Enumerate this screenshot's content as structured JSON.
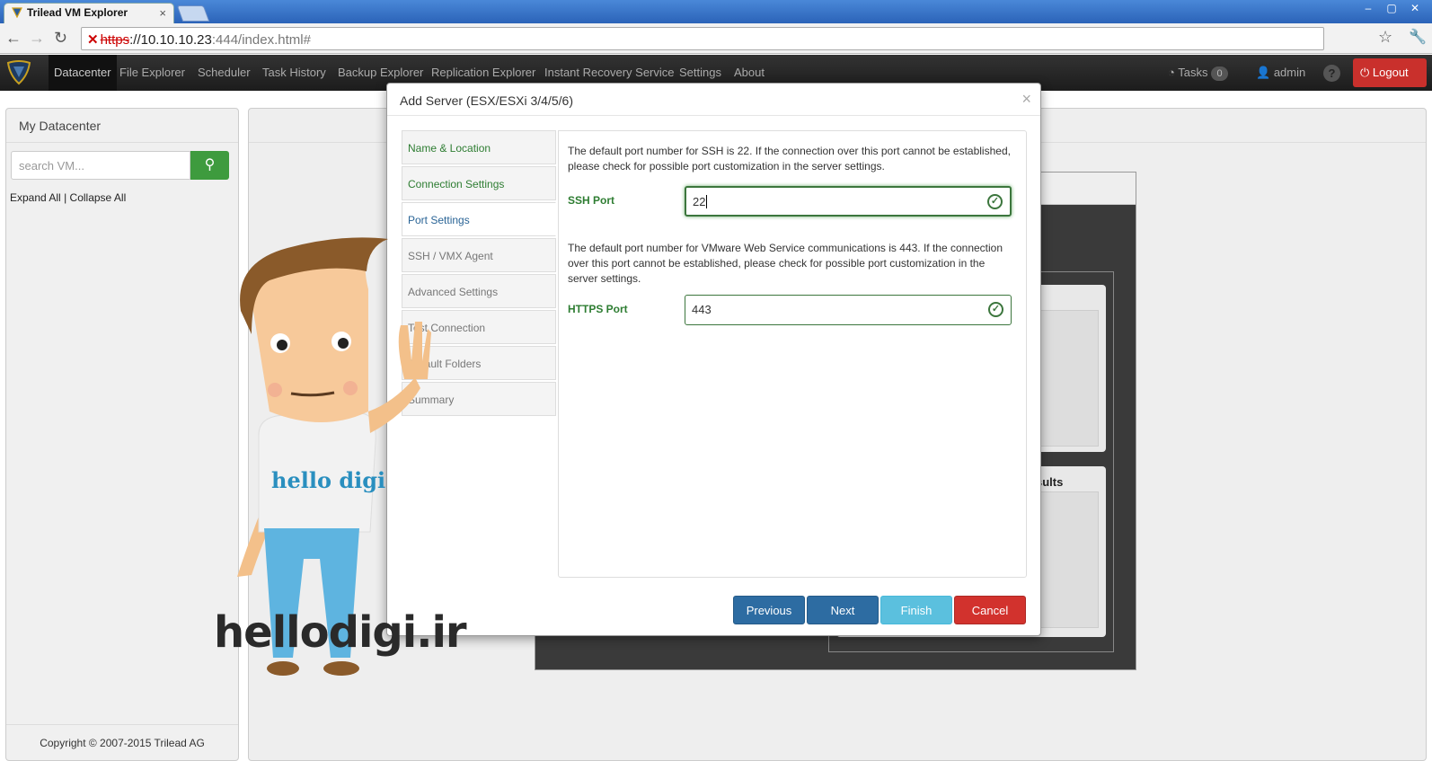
{
  "browser": {
    "tab_title": "Trilead VM Explorer",
    "tab_close": "×",
    "url_scheme": "https",
    "url_host": "://10.10.10.23",
    "url_rest": ":444/index.html#",
    "window_controls": [
      "–",
      "▢",
      "✕"
    ]
  },
  "appnav": {
    "items": [
      "Datacenter",
      "File Explorer",
      "Scheduler",
      "Task History",
      "Backup Explorer",
      "Replication Explorer",
      "Instant Recovery Service",
      "Settings",
      "About"
    ],
    "tasks_label": "Tasks",
    "tasks_count": "0",
    "user": "admin",
    "help": "?",
    "logout": "Logout"
  },
  "left": {
    "title": "My Datacenter",
    "search_placeholder": "search VM...",
    "expand_all": "Expand All",
    "separator": "|",
    "collapse_all": "Collapse All",
    "copyright": "Copyright © 2007-2015 Trilead AG"
  },
  "background": {
    "results_label": "sults"
  },
  "modal": {
    "title": "Add Server (ESX/ESXi 3/4/5/6)",
    "close": "×",
    "steps": [
      "Name & Location",
      "Connection Settings",
      "Port Settings",
      "SSH / VMX Agent",
      "Advanced Settings",
      "Test Connection",
      "Default Folders",
      "Summary"
    ],
    "ssh_desc": "The default port number for SSH is 22. If the connection over this port cannot be established, please check for possible port customization in the server settings.",
    "ssh_label": "SSH Port",
    "ssh_value": "22",
    "https_desc": "The default port number for VMware Web Service communications is 443. If the connection over this port cannot be established, please check for possible port customization in the server settings.",
    "https_label": "HTTPS Port",
    "https_value": "443",
    "buttons": {
      "previous": "Previous",
      "next": "Next",
      "finish": "Finish",
      "cancel": "Cancel"
    }
  },
  "watermark": {
    "shirt": "hello digi",
    "site": "hellodigi.ir"
  },
  "colors": {
    "accent_green": "#3c763d",
    "primary_blue": "#2d6ca2",
    "info": "#5bc0de",
    "danger": "#d2322d"
  }
}
